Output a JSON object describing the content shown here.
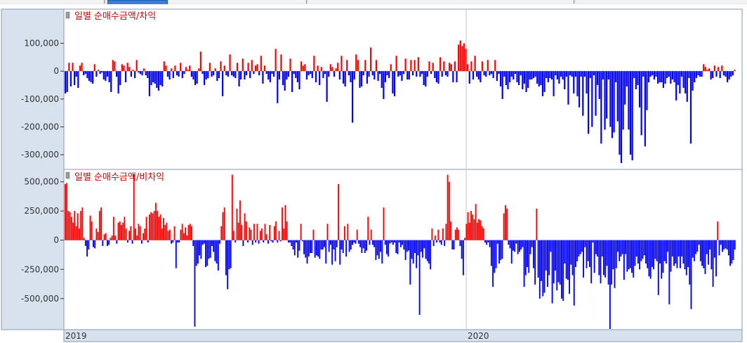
{
  "window": {
    "x_axis_years": [
      "2019",
      "2020"
    ]
  },
  "colors": {
    "positive": "#ff0000",
    "negative": "#0000ff",
    "axis_bg": "#d7e2ee",
    "title": "#cc0000",
    "grid": "#c8c8c8"
  },
  "chart_data": [
    {
      "type": "bar",
      "title": "일별 순매수금액/차익",
      "y_ticks": [
        100000,
        0,
        -100000,
        -200000,
        -300000
      ],
      "y_tick_labels": [
        "100,000",
        "0",
        "-100,000",
        "-200,000",
        "-300,000"
      ],
      "ylim": [
        -350000,
        220000
      ],
      "x_labels": [
        "2019",
        "2020"
      ],
      "grid": true,
      "values": [
        -80000,
        -75000,
        30000,
        -55000,
        30000,
        -50000,
        -20000,
        -60000,
        20000,
        30000,
        -15000,
        -10000,
        -25000,
        -35000,
        -40000,
        -45000,
        25000,
        -20000,
        5000,
        -10000,
        -5000,
        -30000,
        -35000,
        -20000,
        -40000,
        -75000,
        40000,
        35000,
        -20000,
        -80000,
        -50000,
        25000,
        20000,
        -40000,
        30000,
        15000,
        -20000,
        5000,
        -25000,
        40000,
        -5000,
        -10000,
        -15000,
        10000,
        -15000,
        -25000,
        -90000,
        -50000,
        -40000,
        -45000,
        -60000,
        -70000,
        -50000,
        -55000,
        35000,
        20000,
        -20000,
        -30000,
        10000,
        -25000,
        20000,
        -15000,
        -20000,
        30000,
        -25000,
        -10000,
        15000,
        5000,
        20000,
        -20000,
        -30000,
        -50000,
        -45000,
        10000,
        70000,
        -10000,
        -50000,
        -30000,
        -25000,
        30000,
        -20000,
        -15000,
        10000,
        -35000,
        -25000,
        35000,
        -90000,
        20000,
        -15000,
        -20000,
        60000,
        -15000,
        -20000,
        -25000,
        30000,
        -55000,
        -30000,
        45000,
        -30000,
        -15000,
        30000,
        -25000,
        40000,
        -10000,
        20000,
        25000,
        -15000,
        55000,
        -45000,
        20000,
        -10000,
        -30000,
        -40000,
        -10000,
        -20000,
        80000,
        -115000,
        -30000,
        60000,
        -50000,
        -70000,
        -30000,
        -20000,
        45000,
        -75000,
        -10000,
        -25000,
        -40000,
        -65000,
        35000,
        20000,
        25000,
        -30000,
        -15000,
        -10000,
        -25000,
        55000,
        -40000,
        20000,
        -50000,
        15000,
        -25000,
        -10000,
        -110000,
        -20000,
        25000,
        15000,
        -20000,
        10000,
        30000,
        -30000,
        55000,
        -45000,
        -55000,
        40000,
        -15000,
        -40000,
        -185000,
        -30000,
        60000,
        40000,
        -60000,
        -55000,
        -15000,
        40000,
        -45000,
        -20000,
        85000,
        -15000,
        -30000,
        40000,
        -35000,
        -10000,
        -60000,
        -100000,
        -40000,
        -15000,
        -25000,
        25000,
        -80000,
        -90000,
        55000,
        -20000,
        -15000,
        -35000,
        -10000,
        45000,
        -30000,
        -30000,
        40000,
        -15000,
        40000,
        -20000,
        50000,
        -20000,
        -10000,
        -50000,
        -55000,
        -20000,
        35000,
        -10000,
        30000,
        -25000,
        -40000,
        -45000,
        50000,
        -20000,
        35000,
        -15000,
        -20000,
        30000,
        25000,
        -40000,
        35000,
        -40000,
        95000,
        110000,
        90000,
        100000,
        80000,
        25000,
        -45000,
        35000,
        -30000,
        55000,
        -20000,
        -30000,
        -40000,
        35000,
        -15000,
        -20000,
        40000,
        -15000,
        -10000,
        -25000,
        40000,
        -35000,
        -10000,
        -55000,
        -100000,
        -20000,
        -50000,
        -65000,
        -40000,
        -20000,
        -30000,
        -10000,
        -40000,
        -50000,
        -15000,
        -65000,
        -45000,
        -75000,
        -60000,
        -30000,
        -30000,
        -25000,
        -20000,
        -45000,
        -55000,
        -50000,
        -90000,
        -75000,
        -25000,
        -40000,
        -25000,
        -30000,
        -90000,
        -15000,
        -30000,
        -45000,
        -20000,
        -30000,
        -65000,
        -20000,
        -120000,
        -15000,
        -20000,
        -80000,
        -20000,
        -90000,
        -130000,
        -20000,
        -160000,
        -20000,
        -80000,
        -225000,
        -25000,
        -200000,
        -15000,
        -160000,
        -50000,
        -100000,
        -260000,
        -30000,
        -210000,
        -170000,
        -30000,
        -200000,
        -240000,
        -220000,
        -40000,
        -180000,
        -300000,
        -330000,
        -210000,
        -120000,
        -55000,
        -210000,
        -300000,
        -320000,
        -25000,
        -65000,
        -50000,
        -130000,
        -230000,
        -20000,
        -270000,
        -140000,
        -40000,
        -20000,
        -15000,
        -30000,
        -20000,
        -45000,
        -40000,
        -40000,
        -60000,
        -45000,
        -25000,
        -20000,
        -45000,
        -30000,
        -40000,
        -105000,
        -50000,
        -80000,
        -20000,
        -60000,
        -80000,
        -110000,
        -25000,
        -260000,
        -70000,
        -40000,
        -25000,
        -15000,
        -20000,
        -20000,
        25000,
        15000,
        5000,
        10000,
        -30000,
        -25000,
        20000,
        -20000,
        15000,
        -25000,
        20000,
        -15000,
        -20000,
        -40000,
        -30000,
        -20000,
        -15000,
        5000
      ],
      "values_note": ""
    },
    {
      "type": "bar",
      "title": "일별 순매수금액/비차익",
      "y_ticks": [
        500000,
        250000,
        0,
        -250000,
        -500000
      ],
      "y_tick_labels": [
        "500,000",
        "250,000",
        "0",
        "-250,000",
        "-500,000"
      ],
      "ylim": [
        -760000,
        600000
      ],
      "x_labels": [
        "2019",
        "2020"
      ],
      "grid": true,
      "values": [
        480000,
        490000,
        250000,
        240000,
        200000,
        150000,
        250000,
        120000,
        230000,
        100000,
        250000,
        280000,
        20000,
        -50000,
        -140000,
        -80000,
        210000,
        160000,
        -60000,
        -70000,
        100000,
        70000,
        250000,
        280000,
        -50000,
        50000,
        60000,
        -50000,
        -40000,
        20000,
        40000,
        200000,
        40000,
        -30000,
        150000,
        160000,
        130000,
        150000,
        200000,
        100000,
        -20000,
        80000,
        120000,
        -30000,
        560000,
        100000,
        40000,
        140000,
        120000,
        -30000,
        60000,
        100000,
        200000,
        -20000,
        220000,
        240000,
        230000,
        250000,
        320000,
        250000,
        200000,
        220000,
        100000,
        190000,
        130000,
        150000,
        80000,
        90000,
        -30000,
        -20000,
        120000,
        -240000,
        -20000,
        -20000,
        90000,
        140000,
        60000,
        110000,
        40000,
        130000,
        140000,
        120000,
        -50000,
        -740000,
        -220000,
        -200000,
        -130000,
        -160000,
        -40000,
        -30000,
        -230000,
        -220000,
        -160000,
        -150000,
        -50000,
        -100000,
        -180000,
        -200000,
        -260000,
        -30000,
        120000,
        240000,
        280000,
        -300000,
        -420000,
        -250000,
        -240000,
        560000,
        80000,
        -20000,
        270000,
        150000,
        340000,
        130000,
        -50000,
        230000,
        160000,
        -20000,
        110000,
        90000,
        -40000,
        140000,
        -20000,
        140000,
        -30000,
        80000,
        100000,
        -20000,
        140000,
        50000,
        -30000,
        130000,
        -10000,
        -20000,
        120000,
        160000,
        -20000,
        80000,
        -10000,
        280000,
        100000,
        300000,
        160000,
        -20000,
        -20000,
        -50000,
        -80000,
        -130000,
        -20000,
        -150000,
        -90000,
        140000,
        -10000,
        -120000,
        -150000,
        -200000,
        -140000,
        -110000,
        -110000,
        90000,
        -150000,
        -130000,
        -140000,
        -160000,
        -80000,
        -80000,
        -60000,
        -200000,
        140000,
        -100000,
        -40000,
        -210000,
        -80000,
        -180000,
        -60000,
        480000,
        -210000,
        -80000,
        -110000,
        120000,
        -140000,
        140000,
        -100000,
        -80000,
        -40000,
        -20000,
        -30000,
        90000,
        -30000,
        -60000,
        -110000,
        -70000,
        -110000,
        -90000,
        200000,
        -40000,
        90000,
        -40000,
        -60000,
        -170000,
        -130000,
        -160000,
        -100000,
        -200000,
        280000,
        -40000,
        -120000,
        -140000,
        -30000,
        -20000,
        -40000,
        -20000,
        -110000,
        -120000,
        -20000,
        -60000,
        -40000,
        -80000,
        -170000,
        -100000,
        -90000,
        -380000,
        -160000,
        -200000,
        -110000,
        -240000,
        -130000,
        -640000,
        -100000,
        -150000,
        -70000,
        -160000,
        -180000,
        -200000,
        -250000,
        100000,
        -50000,
        40000,
        -20000,
        90000,
        -20000,
        -40000,
        100000,
        -50000,
        140000,
        560000,
        500000,
        160000,
        -80000,
        -80000,
        90000,
        110000,
        90000,
        -50000,
        -160000,
        -300000,
        20000,
        140000,
        240000,
        150000,
        250000,
        220000,
        180000,
        310000,
        150000,
        180000,
        170000,
        120000,
        100000,
        -20000,
        -40000,
        -20000,
        -60000,
        -220000,
        -400000,
        -280000,
        -240000,
        -30000,
        -200000,
        -170000,
        -160000,
        230000,
        300000,
        270000,
        -40000,
        -70000,
        -200000,
        -90000,
        -100000,
        -30000,
        -120000,
        -100000,
        -80000,
        -60000,
        -400000,
        -300000,
        -230000,
        -280000,
        -120000,
        -60000,
        -240000,
        -380000,
        270000,
        -320000,
        -500000,
        -350000,
        -480000,
        -450000,
        -260000,
        -400000,
        -300000,
        -100000,
        -540000,
        -370000,
        -260000,
        -430000,
        -360000,
        -380000,
        -500000,
        -520000,
        -200000,
        -330000,
        -340000,
        -460000,
        -210000,
        -300000,
        -560000,
        -230000,
        -180000,
        -140000,
        -120000,
        -100000,
        -320000,
        -60000,
        -240000,
        -180000,
        -230000,
        -370000,
        -20000,
        -280000,
        -120000,
        -140000,
        -300000,
        -370000,
        -140000,
        -300000,
        -320000,
        -220000,
        -380000,
        -760000,
        -380000,
        -250000,
        -410000,
        -240000,
        -100000,
        -180000,
        -140000,
        -120000,
        -340000,
        -120000,
        -270000,
        -250000,
        -240000,
        -280000,
        -320000,
        -220000,
        -140000,
        -200000,
        -250000,
        -180000,
        -160000,
        -130000,
        -200000,
        -240000,
        -310000,
        -330000,
        -230000,
        -250000,
        -160000,
        -180000,
        -470000,
        -200000,
        -330000,
        -280000,
        -180000,
        -200000,
        -100000,
        -550000,
        -270000,
        -140000,
        -220000,
        -200000,
        -240000,
        -140000,
        -240000,
        -140000,
        -200000,
        -250000,
        -300000,
        -230000,
        -380000,
        -590000,
        -150000,
        -180000,
        -120000,
        -100000,
        -40000,
        -180000,
        -220000,
        -240000,
        -290000,
        -120000,
        -210000,
        -80000,
        -250000,
        -400000,
        -150000,
        -310000,
        160000,
        -130000,
        -40000,
        -100000,
        -80000,
        -70000,
        -80000,
        -130000,
        -220000,
        -200000,
        -170000,
        -80000
      ],
      "values_note": ""
    }
  ]
}
